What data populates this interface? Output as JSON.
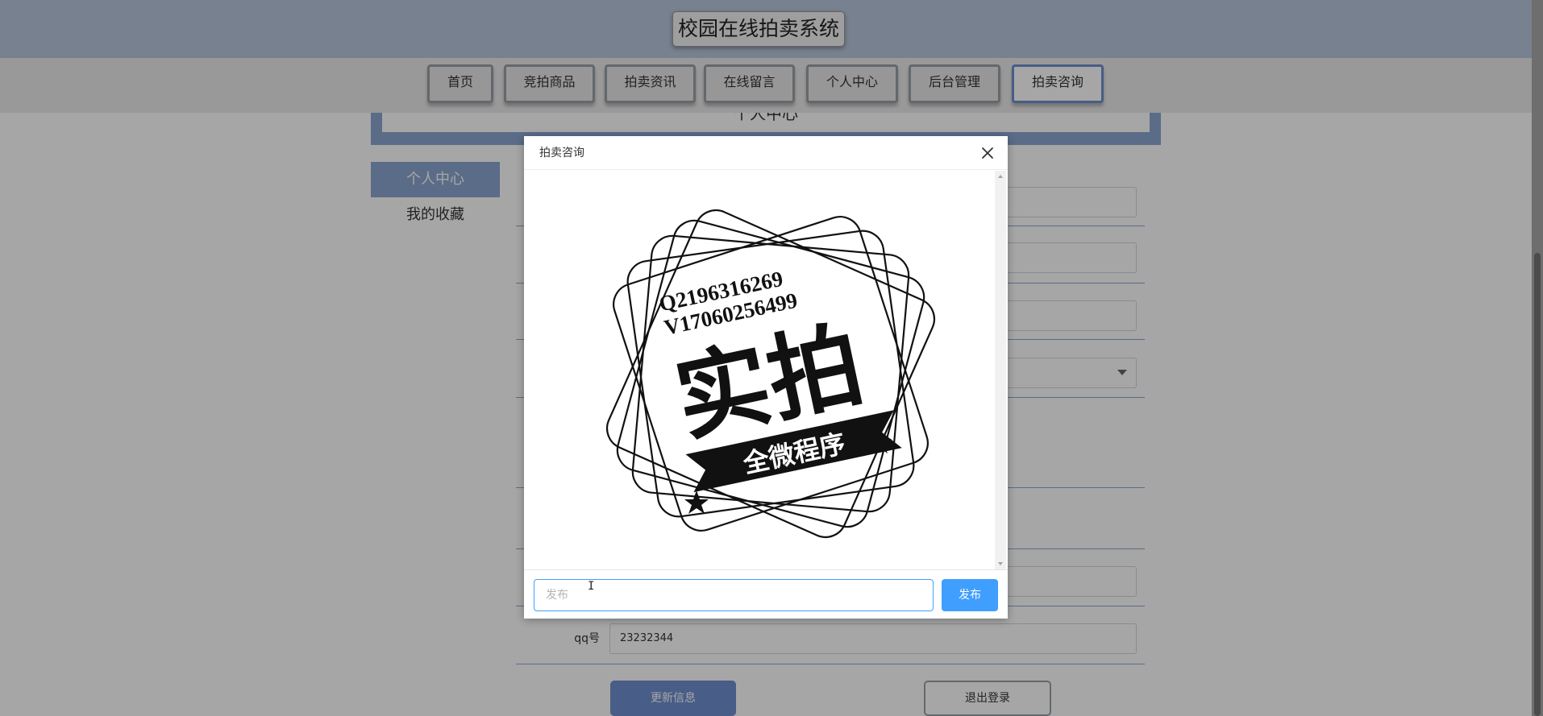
{
  "header": {
    "site_title": "校园在线拍卖系统"
  },
  "nav": {
    "items": [
      {
        "label": "首页"
      },
      {
        "label": "竞拍商品"
      },
      {
        "label": "拍卖资讯"
      },
      {
        "label": "在线留言"
      },
      {
        "label": "个人中心"
      },
      {
        "label": "后台管理"
      },
      {
        "label": "拍卖咨询",
        "active": true
      }
    ]
  },
  "banner": {
    "title": "个人中心"
  },
  "sidebar": {
    "items": [
      {
        "label": "个人中心",
        "active": true
      },
      {
        "label": "我的收藏"
      }
    ]
  },
  "form": {
    "qq_label": "qq号",
    "qq_value": "23232344",
    "update_label": "更新信息",
    "logout_label": "退出登录"
  },
  "dialog": {
    "title": "拍卖咨询",
    "image": {
      "line1": "Q2196316269",
      "line2": "V17060256499",
      "main_text": "实拍",
      "ribbon_text": "全微程序"
    },
    "input_placeholder": "发布",
    "publish_label": "发布"
  },
  "colors": {
    "accent": "#409eff",
    "theme": "#8aa6d0",
    "header_bg": "#b9c7dc"
  }
}
